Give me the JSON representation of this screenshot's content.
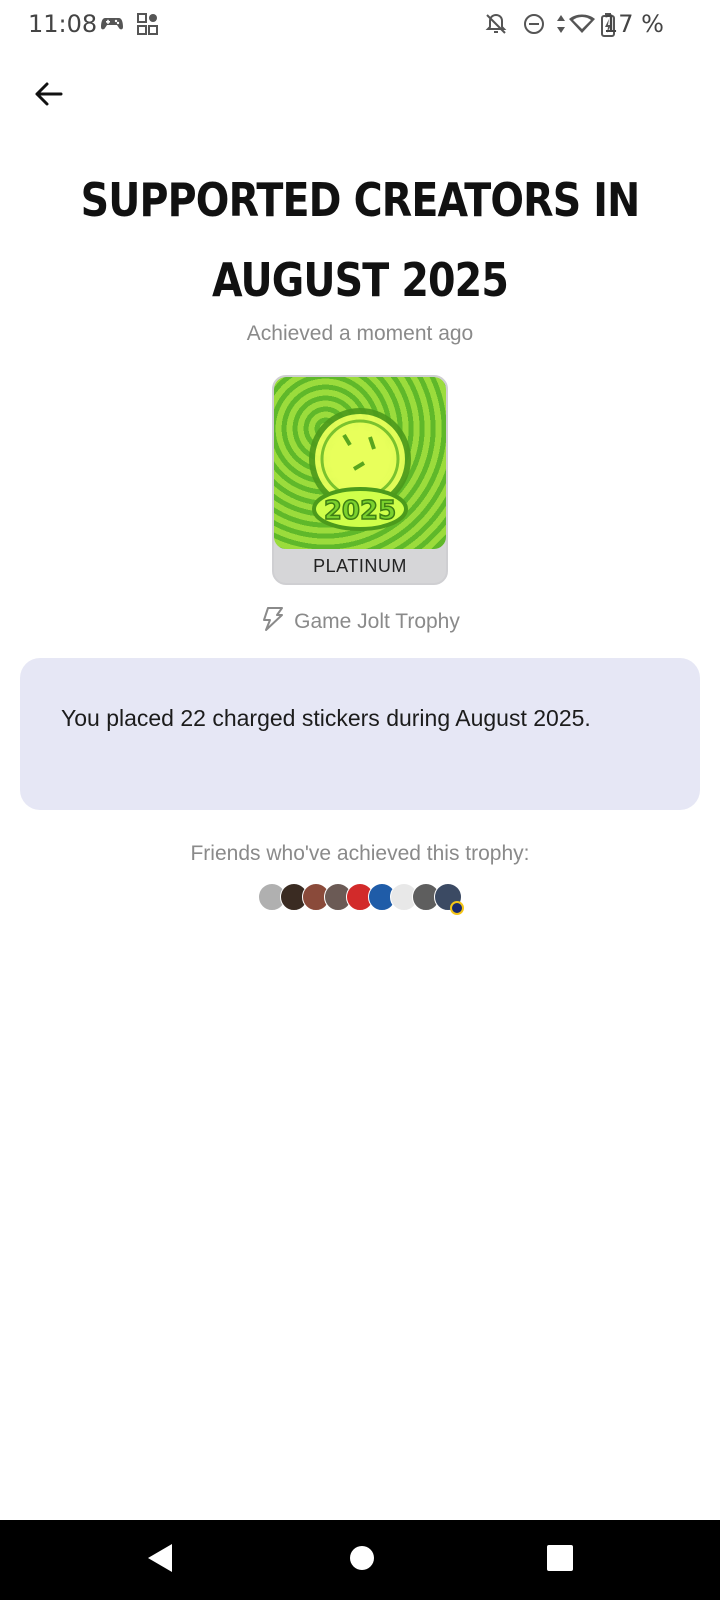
{
  "status_bar": {
    "time": "11:08",
    "battery": "17 %",
    "icons": [
      "gamepad-icon",
      "apps-grid-icon",
      "bell-off-icon",
      "dnd-icon",
      "data-arrows-icon",
      "wifi-icon",
      "battery-charging-icon"
    ]
  },
  "header": {
    "back_icon": "arrow-left-icon"
  },
  "trophy": {
    "title": "SUPPORTED CREATORS IN AUGUST 2025",
    "achieved": "Achieved a moment ago",
    "rank": "PLATINUM",
    "image_text": "2025",
    "source": "Game Jolt Trophy",
    "source_icon": "gamejolt-bolt-icon",
    "description": "You placed 22 charged stickers during August 2025."
  },
  "friends": {
    "label": "Friends who've achieved this trophy:",
    "avatars": [
      {
        "color": "#b0b0b0"
      },
      {
        "color": "#3a2b22"
      },
      {
        "color": "#8a4a3a"
      },
      {
        "color": "#6b5a55"
      },
      {
        "color": "#d22a2a"
      },
      {
        "color": "#1f5ca8"
      },
      {
        "color": "#e8e8e8"
      },
      {
        "color": "#5e5e5e"
      },
      {
        "color": "#3b4a63"
      }
    ]
  },
  "colors": {
    "panel_bg": "#e6e7f5",
    "rank_bg": "#d6d6d8",
    "trophy_green": "#7cc93a"
  }
}
